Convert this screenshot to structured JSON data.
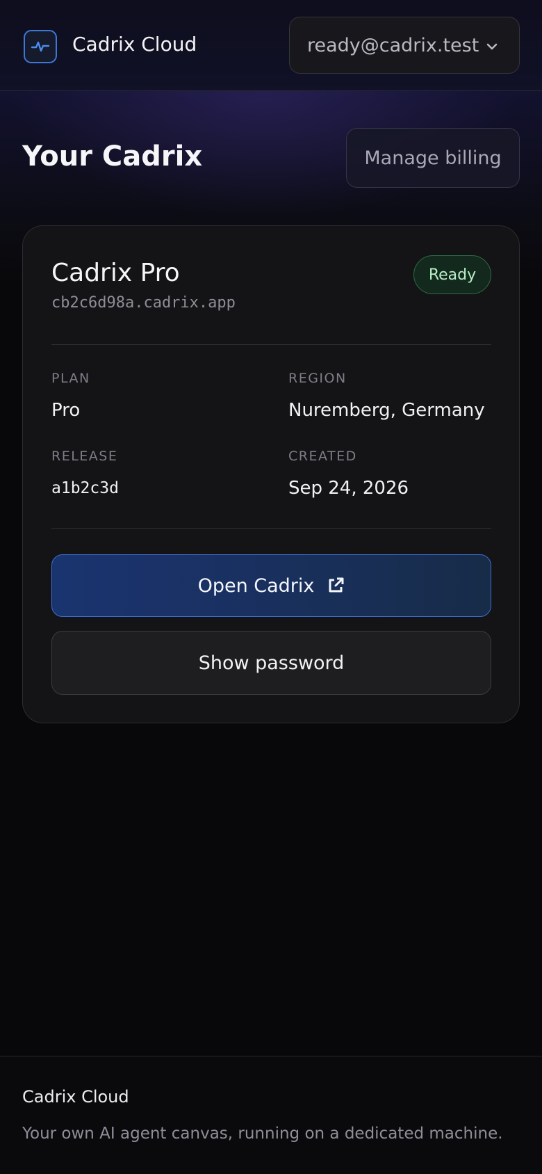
{
  "header": {
    "brand": "Cadrix Cloud",
    "logo_icon": "activity-pulse-icon",
    "account_email": "ready@cadrix.test",
    "account_icon": "chevron-down-icon"
  },
  "page": {
    "title": "Your Cadrix",
    "billing_button": "Manage billing"
  },
  "card": {
    "title": "Cadrix Pro",
    "host": "cb2c6d98a.cadrix.app",
    "status": "Ready",
    "fields": {
      "plan_label": "PLAN",
      "plan_value": "Pro",
      "region_label": "REGION",
      "region_value": "Nuremberg, Germany",
      "release_label": "RELEASE",
      "release_value": "a1b2c3d",
      "created_label": "CREATED",
      "created_value": "Sep 24, 2026"
    },
    "open_button": "Open Cadrix",
    "open_icon": "external-link-icon",
    "password_button": "Show password"
  },
  "colors": {
    "accent": "#3d78d8",
    "status_ready": "#b7f0c8",
    "background": "#08080a"
  },
  "footer": {
    "brand": "Cadrix Cloud",
    "tagline": "Your own AI agent canvas, running on a dedicated machine."
  }
}
